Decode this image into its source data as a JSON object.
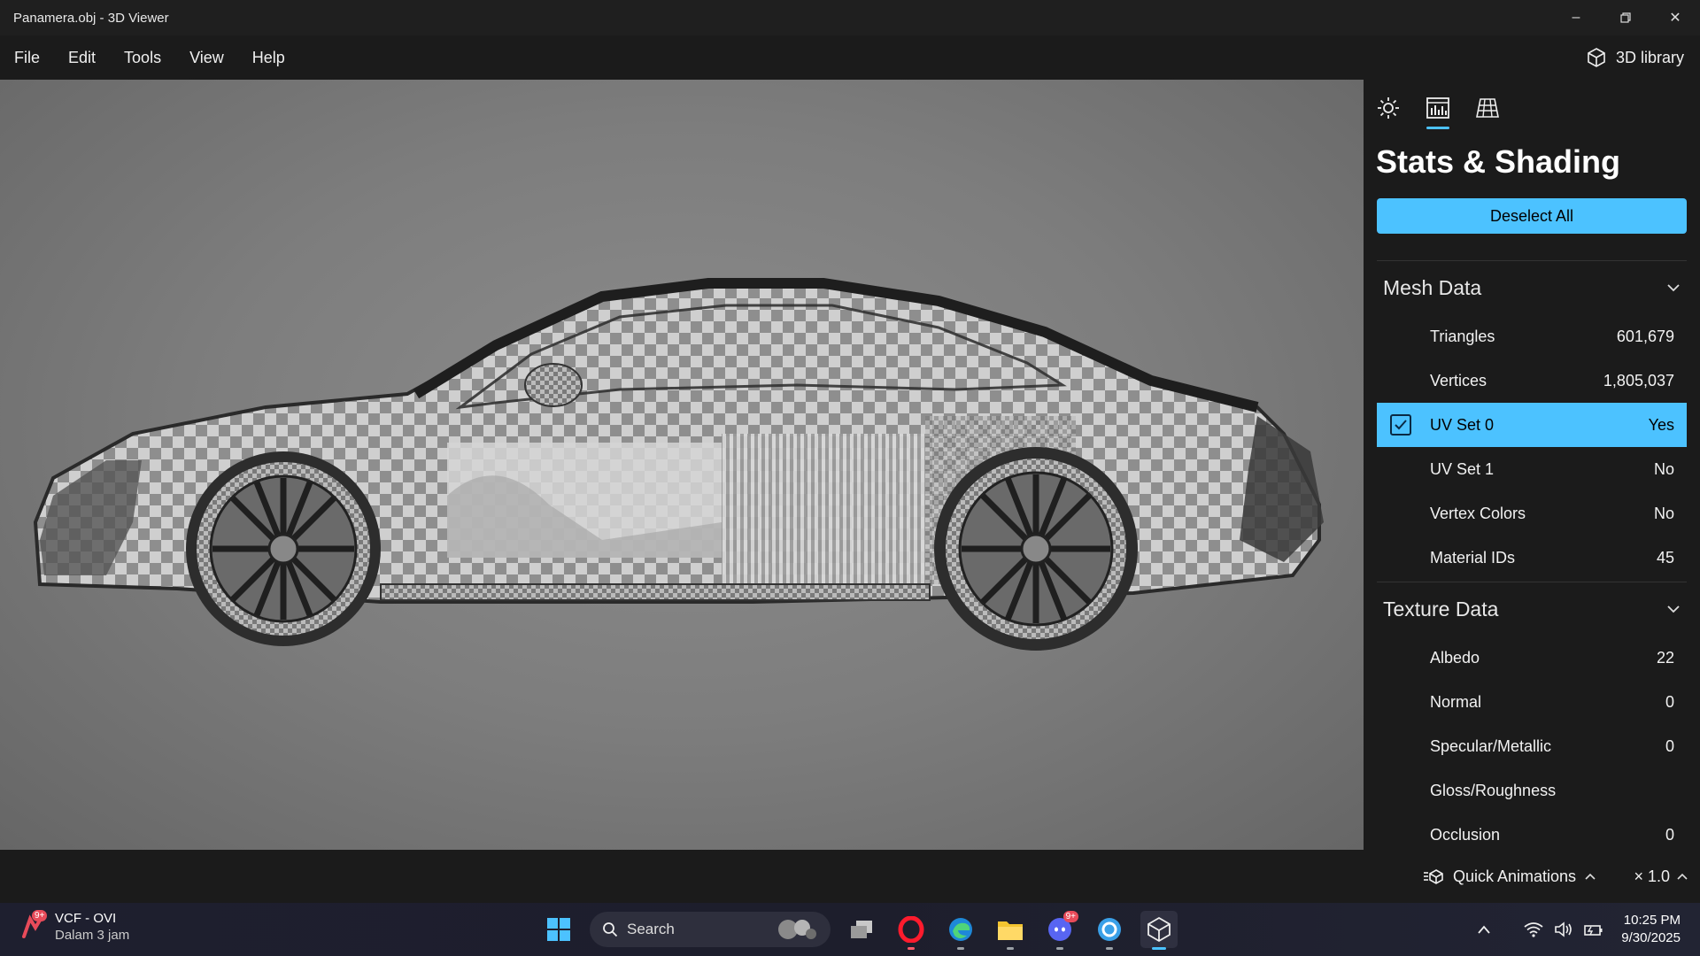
{
  "window": {
    "title": "Panamera.obj - 3D Viewer",
    "controls": [
      "minimize-icon",
      "restore-icon",
      "close-icon"
    ]
  },
  "menu": {
    "items": [
      "File",
      "Edit",
      "Tools",
      "View",
      "Help"
    ],
    "library_label": "3D library"
  },
  "panel": {
    "tabs": [
      "sun-icon",
      "stats-icon",
      "grid-icon"
    ],
    "active_tab": 1,
    "title": "Stats & Shading",
    "deselect_label": "Deselect All",
    "mesh": {
      "heading": "Mesh Data",
      "rows": [
        {
          "label": "Triangles",
          "value": "601,679"
        },
        {
          "label": "Vertices",
          "value": "1,805,037"
        },
        {
          "label": "UV Set 0",
          "value": "Yes",
          "selected": true
        },
        {
          "label": "UV Set 1",
          "value": "No"
        },
        {
          "label": "Vertex Colors",
          "value": "No"
        },
        {
          "label": "Material IDs",
          "value": "45"
        }
      ]
    },
    "texture": {
      "heading": "Texture Data",
      "rows": [
        {
          "label": "Albedo",
          "value": "22"
        },
        {
          "label": "Normal",
          "value": "0"
        },
        {
          "label": "Specular/Metallic",
          "value": "0"
        },
        {
          "label": "Gloss/Roughness",
          "value": ""
        },
        {
          "label": "Occlusion",
          "value": "0"
        }
      ]
    }
  },
  "bottom": {
    "quick_animations": "Quick Animations",
    "speed": "× 1.0"
  },
  "taskbar": {
    "notification_title": "VCF - OVI",
    "notification_sub": "Dalam 3 jam",
    "notification_badge": "9+",
    "search_placeholder": "Search",
    "discord_badge": "9+",
    "time": "10:25 PM",
    "date": "9/30/2025"
  },
  "colors": {
    "accent": "#4cc2ff",
    "panel_bg": "#1b1b1b"
  }
}
